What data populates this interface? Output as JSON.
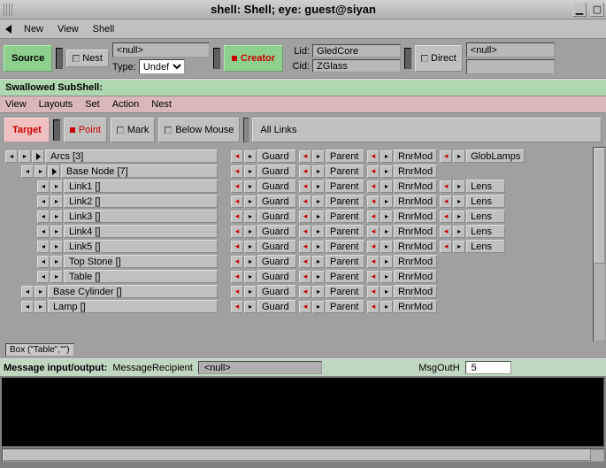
{
  "title": "shell: Shell; eye: guest@siyan",
  "menu": {
    "new": "New",
    "view": "View",
    "shell": "Shell"
  },
  "toolbar1": {
    "source": "Source",
    "nest": "Nest",
    "null_field": "<null>",
    "type_label": "Type:",
    "type_value": "Undef",
    "creator": "Creator",
    "lid_label": "Lid:",
    "lid_value": "GledCore",
    "cid_label": "Cid:",
    "cid_value": "ZGlass",
    "direct": "Direct",
    "direct_null": "<null>"
  },
  "subshell": "Swallowed SubShell:",
  "menu2": {
    "view": "View",
    "layouts": "Layouts",
    "set": "Set",
    "action": "Action",
    "nest": "Nest"
  },
  "toolbar2": {
    "target": "Target",
    "point": "Point",
    "mark": "Mark",
    "below": "Below Mouse",
    "all_links": "All Links"
  },
  "link_labels": {
    "guard": "Guard",
    "parent": "Parent",
    "rnrmod": "RnrMod",
    "globlamps": "GlobLamps",
    "lens": "Lens"
  },
  "tree": [
    {
      "indent": 0,
      "label": "Arcs [3]",
      "links": [
        "guard",
        "parent",
        "rnrmod",
        "globlamps"
      ],
      "expand": true
    },
    {
      "indent": 1,
      "label": "Base Node [7]",
      "links": [
        "guard",
        "parent",
        "rnrmod"
      ],
      "expand": true
    },
    {
      "indent": 2,
      "label": "Link1 []",
      "links": [
        "guard",
        "parent",
        "rnrmod",
        "lens"
      ]
    },
    {
      "indent": 2,
      "label": "Link2 []",
      "links": [
        "guard",
        "parent",
        "rnrmod",
        "lens"
      ]
    },
    {
      "indent": 2,
      "label": "Link3 []",
      "links": [
        "guard",
        "parent",
        "rnrmod",
        "lens"
      ]
    },
    {
      "indent": 2,
      "label": "Link4 []",
      "links": [
        "guard",
        "parent",
        "rnrmod",
        "lens"
      ]
    },
    {
      "indent": 2,
      "label": "Link5 []",
      "links": [
        "guard",
        "parent",
        "rnrmod",
        "lens"
      ]
    },
    {
      "indent": 2,
      "label": "Top Stone []",
      "links": [
        "guard",
        "parent",
        "rnrmod"
      ]
    },
    {
      "indent": 2,
      "label": "Table []",
      "links": [
        "guard",
        "parent",
        "rnrmod"
      ]
    },
    {
      "indent": 1,
      "label": "Base Cylinder []",
      "links": [
        "guard",
        "parent",
        "rnrmod"
      ]
    },
    {
      "indent": 1,
      "label": "Lamp []",
      "links": [
        "guard",
        "parent",
        "rnrmod"
      ]
    }
  ],
  "status": "Box (\"Table\",\"\")",
  "msgbar": {
    "label": "Message input/output:",
    "recipient_label": "MessageRecipient",
    "recipient_value": "<null>",
    "msgout_label": "MsgOutH",
    "msgout_value": "5"
  }
}
